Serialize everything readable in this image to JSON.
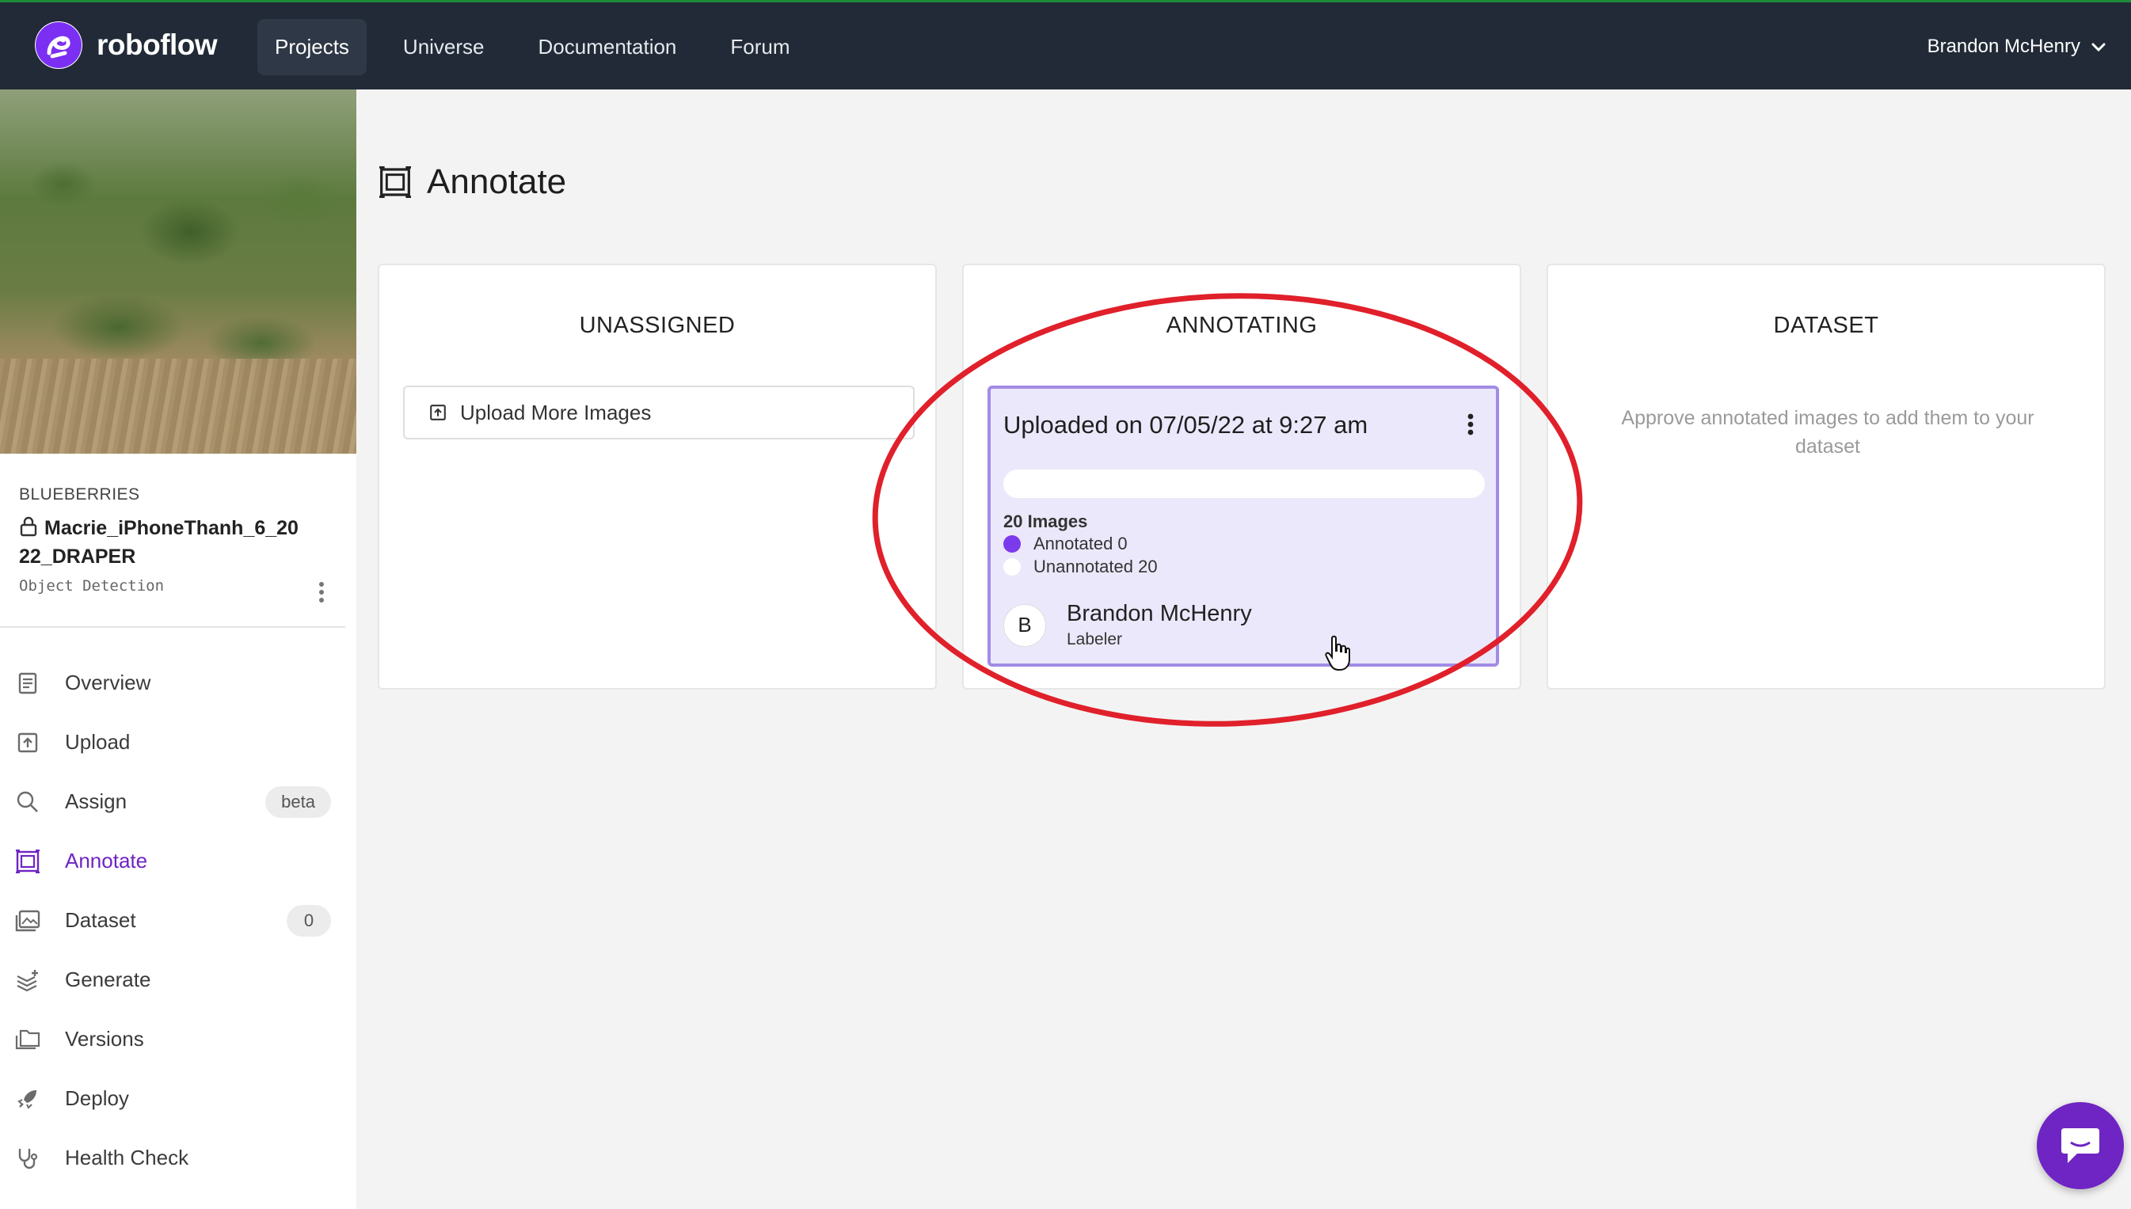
{
  "brand": {
    "name": "roboflow",
    "accent": "#6f24c4",
    "nav_bg": "#212a36"
  },
  "nav": {
    "items": [
      {
        "label": "Projects",
        "active": true
      },
      {
        "label": "Universe",
        "active": false
      },
      {
        "label": "Documentation",
        "active": false
      },
      {
        "label": "Forum",
        "active": false
      }
    ],
    "user": "Brandon McHenry"
  },
  "project": {
    "group": "BLUEBERRIES",
    "name": "Macrie_iPhoneThanh_6_2022_DRAPER",
    "type": "Object Detection",
    "thumbnail_icon": "blueberry-field-photo"
  },
  "sidebar": {
    "items": [
      {
        "label": "Overview",
        "icon": "document-icon"
      },
      {
        "label": "Upload",
        "icon": "upload-icon"
      },
      {
        "label": "Assign",
        "icon": "search-icon",
        "badge": "beta"
      },
      {
        "label": "Annotate",
        "icon": "annotate-icon",
        "active": true
      },
      {
        "label": "Dataset",
        "icon": "images-icon",
        "badge": "0"
      },
      {
        "label": "Generate",
        "icon": "layers-plus-icon"
      },
      {
        "label": "Versions",
        "icon": "folders-icon"
      },
      {
        "label": "Deploy",
        "icon": "rocket-icon"
      },
      {
        "label": "Health Check",
        "icon": "stethoscope-icon"
      }
    ]
  },
  "page": {
    "title": "Annotate",
    "icon": "annotate-icon"
  },
  "columns": {
    "unassigned": {
      "title": "UNASSIGNED",
      "upload_button": "Upload More Images"
    },
    "annotating": {
      "title": "ANNOTATING",
      "batch": {
        "title": "Uploaded on 07/05/22 at 9:27 am",
        "progress": 0,
        "count_label": "20 Images",
        "annotated_label": "Annotated 0",
        "unannotated_label": "Unannotated 20",
        "assignee": {
          "initial": "B",
          "name": "Brandon McHenry",
          "role": "Labeler"
        }
      }
    },
    "dataset": {
      "title": "DATASET",
      "hint": "Approve annotated images to add them to your dataset"
    }
  },
  "colors": {
    "highlight_ellipse": "#e0202a",
    "card_bg": "#ece8fb",
    "card_border": "#a28be6"
  }
}
